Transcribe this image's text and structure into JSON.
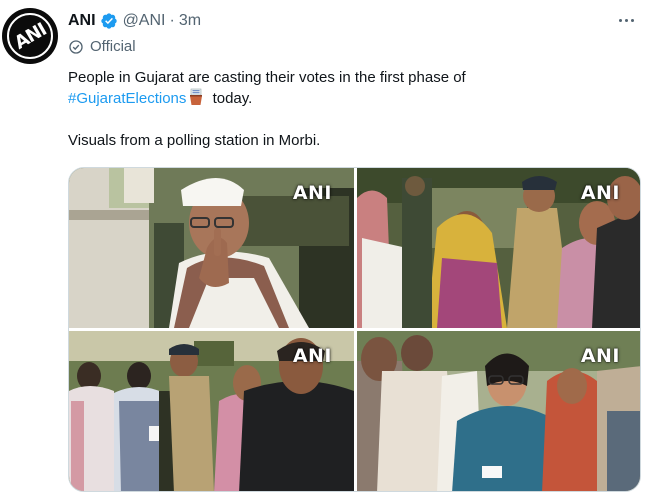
{
  "tweet": {
    "author_name": "ANI",
    "handle": "@ANI",
    "separator": "·",
    "time": "3m",
    "label": "Official",
    "line1": "People in Gujarat are casting their votes in the first phase of",
    "hashtag": "#GujaratElections",
    "line2_after": " today.",
    "line3": "Visuals from a polling station in Morbi."
  },
  "media": {
    "watermark": "ANI",
    "photos": [
      {
        "watermark": "ANI"
      },
      {
        "watermark": "ANI"
      },
      {
        "watermark": "ANI"
      },
      {
        "watermark": "ANI"
      }
    ]
  },
  "colors": {
    "text": "#0f1419",
    "secondary": "#536471",
    "link": "#1d9bf0",
    "verified": "#1d9bf0"
  },
  "icons": {
    "verified": "verified-badge-icon",
    "official": "official-badge-icon",
    "more": "more-options-icon",
    "ballot": "ballot-box-emoji"
  }
}
